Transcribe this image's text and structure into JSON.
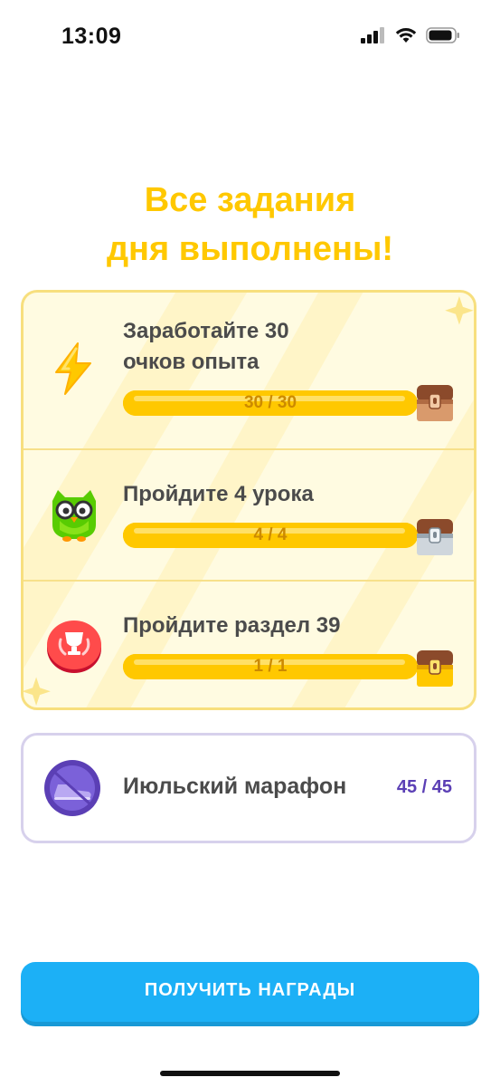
{
  "status": {
    "time": "13:09"
  },
  "header": {
    "title_line1": "Все задания",
    "title_line2": "дня выполнены!"
  },
  "quests": [
    {
      "title_line1": "Заработайте 30",
      "title_line2": "очков опыта",
      "progress_text": "30 / 30",
      "progress": 1.0,
      "icon": "lightning-icon",
      "chest": "bronze-chest-icon"
    },
    {
      "title_line1": "Пройдите 4 урока",
      "title_line2": "",
      "progress_text": "4 / 4",
      "progress": 1.0,
      "icon": "owl-icon",
      "chest": "silver-chest-icon"
    },
    {
      "title_line1": "Пройдите раздел 39",
      "title_line2": "",
      "progress_text": "1 / 1",
      "progress": 1.0,
      "icon": "trophy-badge-icon",
      "chest": "gold-chest-icon"
    }
  ],
  "marathon": {
    "title": "Июльский марафон",
    "count": "45 / 45",
    "icon": "sneaker-badge-icon"
  },
  "button": {
    "label": "ПОЛУЧИТЬ НАГРАДЫ"
  },
  "colors": {
    "title": "#ffc800",
    "progress": "#ffc800",
    "button": "#1cb0f6",
    "marathon_count": "#5b3fb5"
  }
}
